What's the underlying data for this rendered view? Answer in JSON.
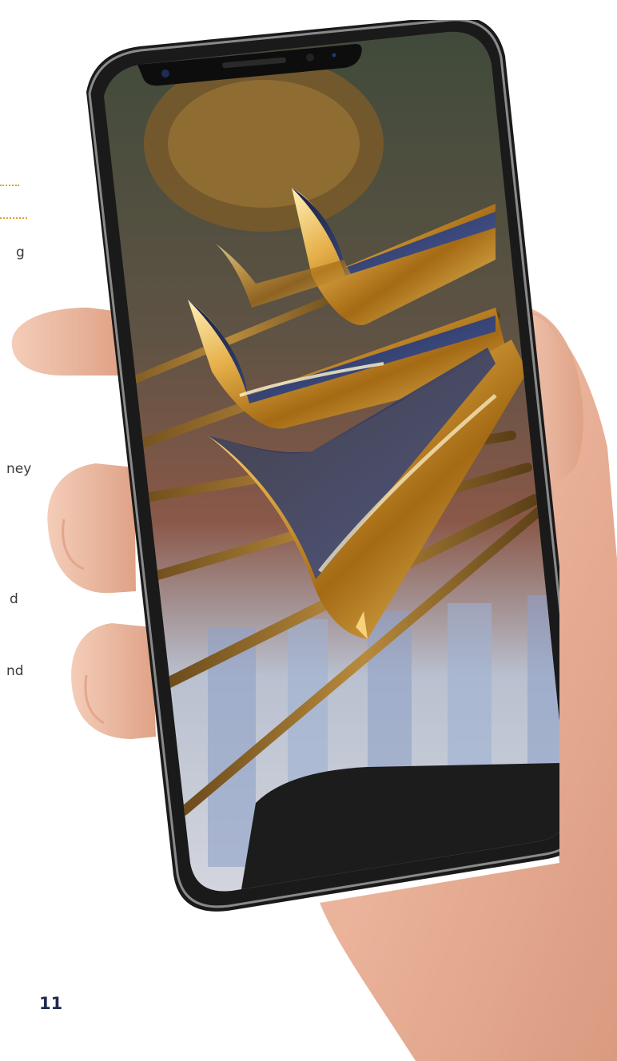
{
  "left_fragments": [
    {
      "text": "g"
    },
    {
      "text": "ney"
    },
    {
      "text": "d"
    },
    {
      "text": "nd"
    }
  ],
  "photo": {
    "subject": "trombone-bells-photo"
  },
  "page_number": "11",
  "colors": {
    "accent_dots": "#d9a23a",
    "page_number": "#1e2a4f",
    "body_text": "#3a3a3a"
  }
}
